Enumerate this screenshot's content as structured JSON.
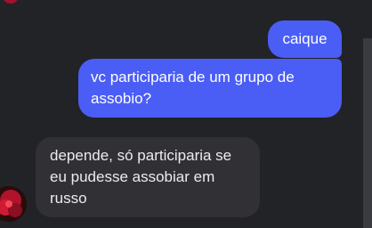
{
  "conversation": {
    "messages": [
      {
        "direction": "outgoing",
        "text": "caique"
      },
      {
        "direction": "outgoing",
        "text": "vc participaria de um grupo de assobio?"
      },
      {
        "direction": "incoming",
        "text": "depende, só participaria se eu pudesse assobiar em russo"
      }
    ]
  },
  "colors": {
    "background": "#222327",
    "outgoing_bubble": "#4a5ef6",
    "incoming_bubble": "#303035",
    "text": "#ffffff"
  },
  "icons": {
    "sender_avatar": "avatar-icon"
  }
}
